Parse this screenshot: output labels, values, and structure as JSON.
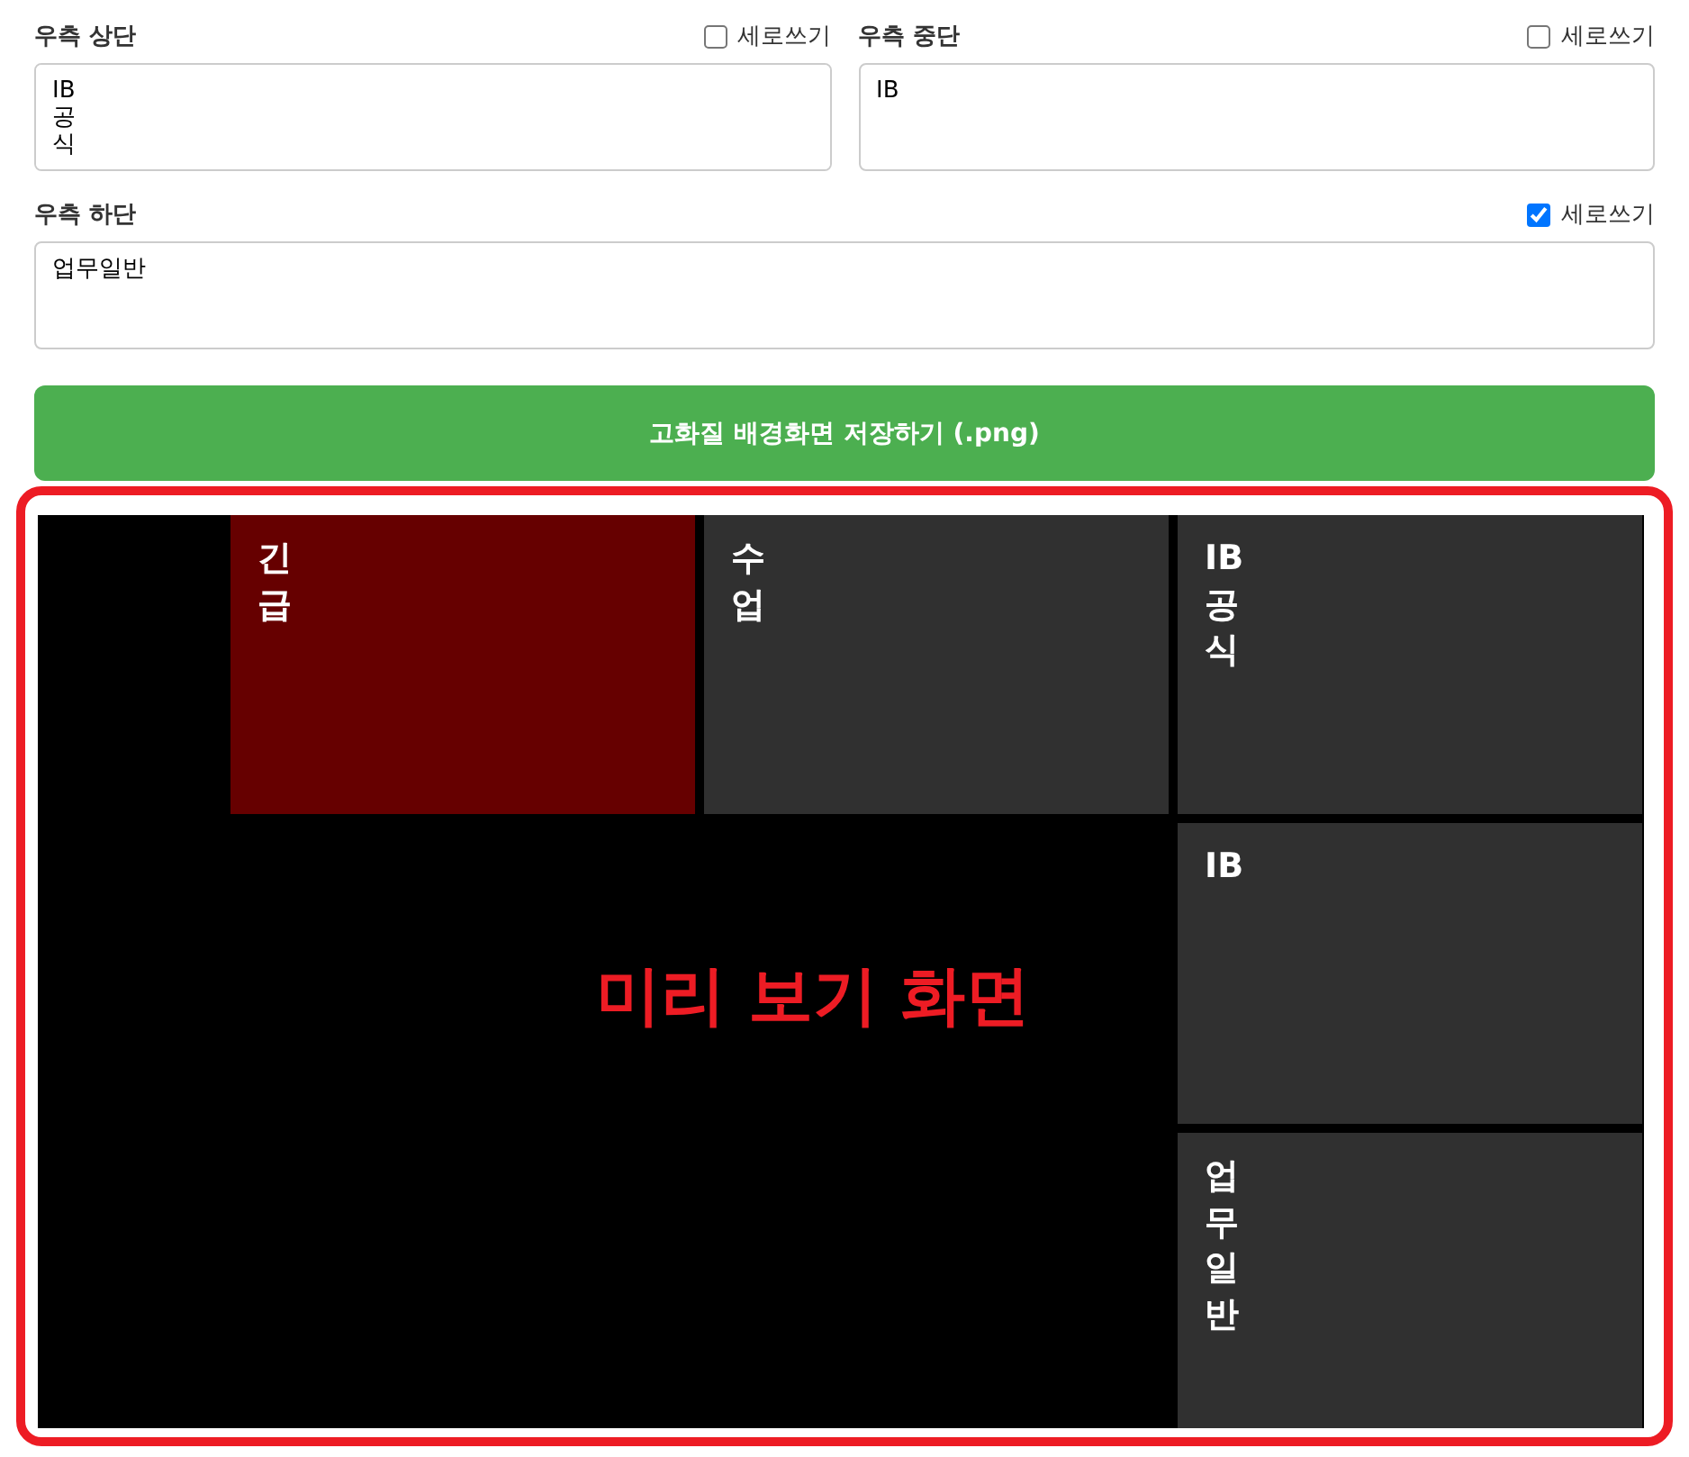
{
  "fields": [
    {
      "label": "우측 상단",
      "vertical_label": "세로쓰기",
      "vertical": false,
      "value": "IB\n공\n식"
    },
    {
      "label": "우측 중단",
      "vertical_label": "세로쓰기",
      "vertical": false,
      "value": "IB"
    },
    {
      "label": "우측 하단",
      "vertical_label": "세로쓰기",
      "vertical": true,
      "value": "업무일반"
    }
  ],
  "save_button": "고화질 배경화면 저장하기 (.png)",
  "preview": {
    "caption": "미리 보기 화면",
    "tiles": [
      {
        "text": "긴\n급",
        "color": "#660000",
        "vertical": false
      },
      {
        "text": "수\n업",
        "color": "#303030",
        "vertical": false
      },
      {
        "text": "IB\n공\n식",
        "color": "#303030",
        "vertical": false
      },
      {
        "text": "IB",
        "color": "#303030",
        "vertical": false
      },
      {
        "text": "업무일반",
        "color": "#303030",
        "vertical": true
      }
    ]
  }
}
